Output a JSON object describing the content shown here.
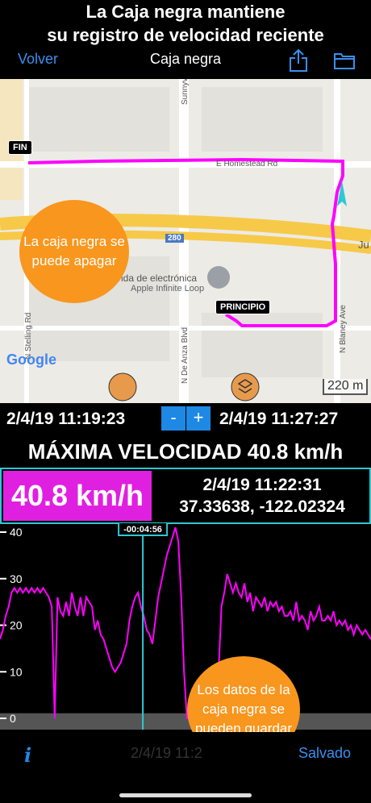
{
  "banner": {
    "line1": "La Caja negra mantiene",
    "line2": "su registro de velocidad reciente"
  },
  "nav": {
    "back": "Volver",
    "title": "Caja negra"
  },
  "map": {
    "end_label": "FIN",
    "start_label": "PRINCIPIO",
    "bubble": "La caja negra se puede apagar",
    "roads": {
      "sunnyvale": "Sunnyvale S",
      "homestead": "E Homestead Rd",
      "sterling": "N Stelling Rd",
      "deanza": "N De Anza Blvd",
      "blaney": "N Blaney Ave",
      "hwy": "280",
      "ju": "Ju"
    },
    "places": {
      "store_line1": "nda de electrónica",
      "store_line2": "Apple Infinite Loop"
    },
    "google": "Google",
    "scale": "220 m",
    "colors": {
      "route": "#ff00ff",
      "bubble": "#f8961e",
      "highway": "#f7c948"
    }
  },
  "range": {
    "start": "2/4/19 11:19:23",
    "minus": "-",
    "plus": "+",
    "end": "2/4/19 11:27:27"
  },
  "max_speed": "MÁXIMA VELOCIDAD 40.8 km/h",
  "current": {
    "speed": "40.8 km/h",
    "timestamp": "2/4/19 11:22:31",
    "coords": "37.33638, -122.02324"
  },
  "chart_data": {
    "type": "line",
    "y_ticks": [
      "40",
      "30",
      "20",
      "10",
      "0"
    ],
    "ylim": [
      0,
      40
    ],
    "cursor_label": "-00:04:56",
    "series": [
      {
        "values": [
          17,
          19,
          22,
          24,
          27,
          28,
          27,
          28,
          27,
          28,
          27,
          28,
          27,
          28,
          27,
          28,
          27,
          26,
          24,
          0,
          26,
          23,
          22,
          25,
          22,
          27,
          24,
          22,
          26,
          22,
          26,
          25,
          24,
          19,
          21,
          18,
          17,
          15,
          13,
          11,
          10,
          11,
          12,
          14,
          16,
          21,
          24,
          26,
          27,
          24,
          22,
          19,
          18,
          16,
          21,
          26,
          29,
          32,
          35,
          37,
          39,
          41,
          38,
          26,
          10,
          0,
          0,
          0,
          0,
          0,
          0,
          0,
          0,
          0,
          0,
          0,
          10,
          24,
          27,
          31,
          29,
          27,
          29,
          27,
          26,
          29,
          25,
          27,
          23,
          26,
          25,
          24,
          26,
          23,
          25,
          24,
          25,
          23,
          24,
          22,
          22,
          23,
          21,
          25,
          21,
          22,
          21,
          19,
          23,
          21,
          22,
          24,
          21,
          21,
          22,
          21,
          23,
          20,
          21,
          20,
          21,
          19,
          20,
          18,
          20,
          19,
          18,
          19,
          18,
          17
        ],
        "color": "#ff00ff"
      }
    ],
    "cursor_fraction": 0.385
  },
  "chart_overlay": {
    "bubble": "Los datos de la caja negra se pueden guardar"
  },
  "bottom": {
    "info": "i",
    "ghost_time": "2/4/19 11:2",
    "saved": "Salvado"
  }
}
